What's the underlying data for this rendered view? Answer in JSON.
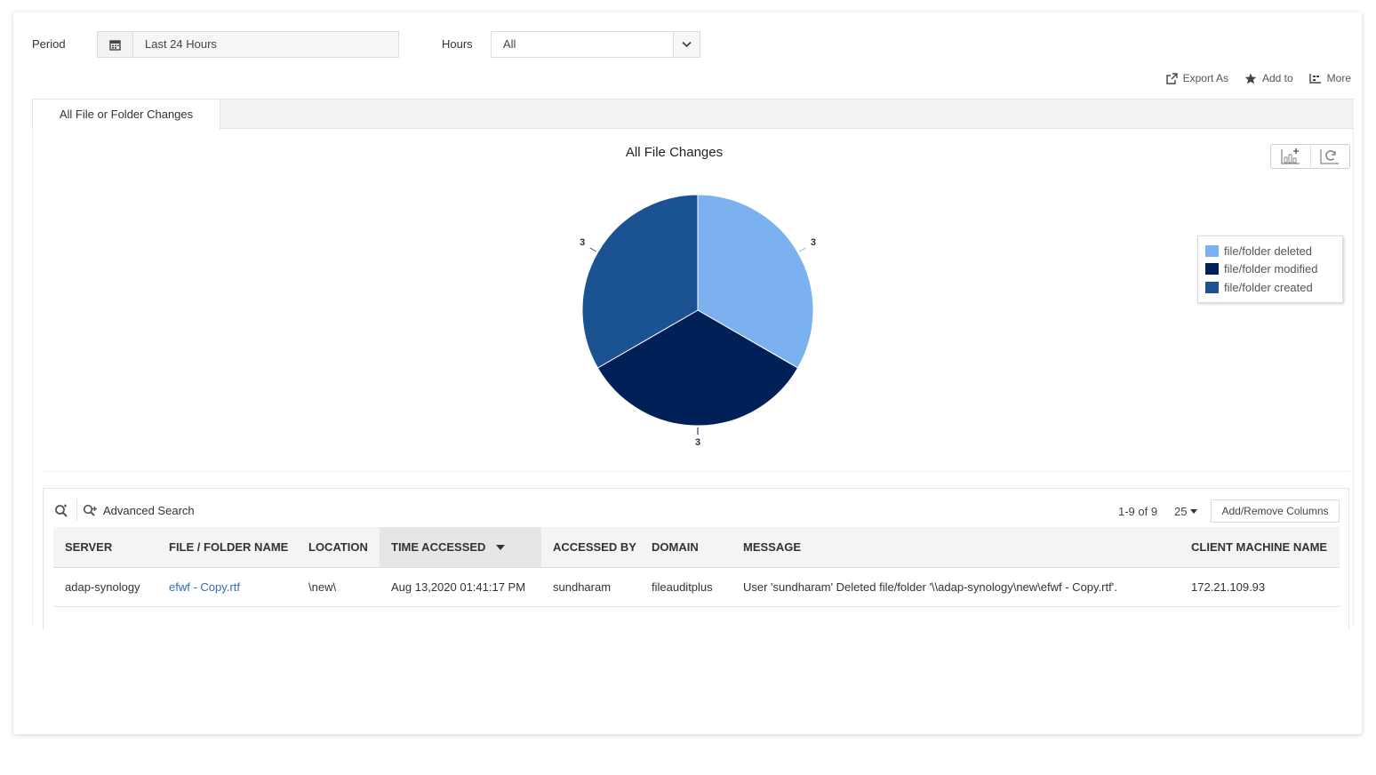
{
  "filters": {
    "period_label": "Period",
    "period_value": "Last 24 Hours",
    "hours_label": "Hours",
    "hours_value": "All"
  },
  "actions": {
    "export": "Export As",
    "add_to": "Add to",
    "more": "More"
  },
  "tabs": [
    {
      "label": "All File or Folder Changes",
      "active": true
    }
  ],
  "chart_data": {
    "type": "pie",
    "title": "All File Changes",
    "categories": [
      "file/folder deleted",
      "file/folder modified",
      "file/folder created"
    ],
    "values": [
      3,
      3,
      3
    ],
    "colors": [
      "#7ab1ee",
      "#012058",
      "#1b5392"
    ],
    "data_labels": [
      "3",
      "3",
      "3"
    ],
    "legend_position": "right"
  },
  "grid": {
    "advanced_search": "Advanced Search",
    "pager": "1-9 of 9",
    "per_page": "25",
    "add_remove_columns": "Add/Remove Columns",
    "columns": [
      "SERVER",
      "FILE / FOLDER NAME",
      "LOCATION",
      "TIME ACCESSED",
      "ACCESSED BY",
      "DOMAIN",
      "MESSAGE",
      "CLIENT MACHINE NAME"
    ],
    "sorted_column": "TIME ACCESSED",
    "rows": [
      {
        "server": "adap-synology",
        "file_name": "efwf - Copy.rtf",
        "location": "\\new\\",
        "time_accessed": "Aug 13,2020 01:41:17 PM",
        "accessed_by": "sundharam",
        "domain": "fileauditplus",
        "message": "User 'sundharam' Deleted file/folder '\\\\adap-synology\\new\\efwf - Copy.rtf'.",
        "client_machine": "172.21.109.93"
      }
    ]
  },
  "colors": {
    "link": "#2e6fb3",
    "tab_bg": "#f2f2f2"
  }
}
